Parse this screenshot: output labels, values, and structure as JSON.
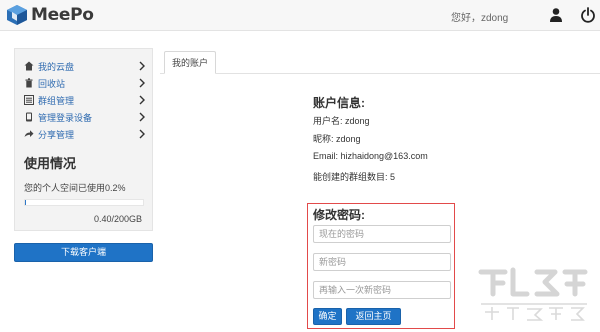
{
  "app": {
    "name": "MeePo"
  },
  "header": {
    "greeting": "您好，zdong",
    "user_icon": "user-icon",
    "power_icon": "power-icon"
  },
  "sidebar": {
    "items": [
      {
        "label": "我的云盘",
        "icon": "home-icon"
      },
      {
        "label": "回收站",
        "icon": "trash-icon"
      },
      {
        "label": "群组管理",
        "icon": "group-icon"
      },
      {
        "label": "管理登录设备",
        "icon": "device-icon"
      },
      {
        "label": "分享管理",
        "icon": "share-icon"
      }
    ],
    "usage": {
      "title": "使用情况",
      "text": "您的个人空间已使用0.2%",
      "fraction": 0.002,
      "amount": "0.40/200GB"
    }
  },
  "download_button": "下载客户端",
  "tabs": [
    {
      "label": "我的账户"
    }
  ],
  "account": {
    "title": "账户信息:",
    "username": "用户名: zdong",
    "nickname": "昵称: zdong",
    "email": "Email: hizhaidong@163.com",
    "groups": "能创建的群组数目: 5"
  },
  "password": {
    "title": "修改密码:",
    "current_placeholder": "现在的密码",
    "new_placeholder": "新密码",
    "confirm_placeholder": "再输入一次新密码",
    "confirm_button": "确定",
    "home_button": "返回主页"
  },
  "colors": {
    "accent": "#1f73c6",
    "link": "#2f6bb0",
    "highlight_border": "#e24a4a"
  }
}
